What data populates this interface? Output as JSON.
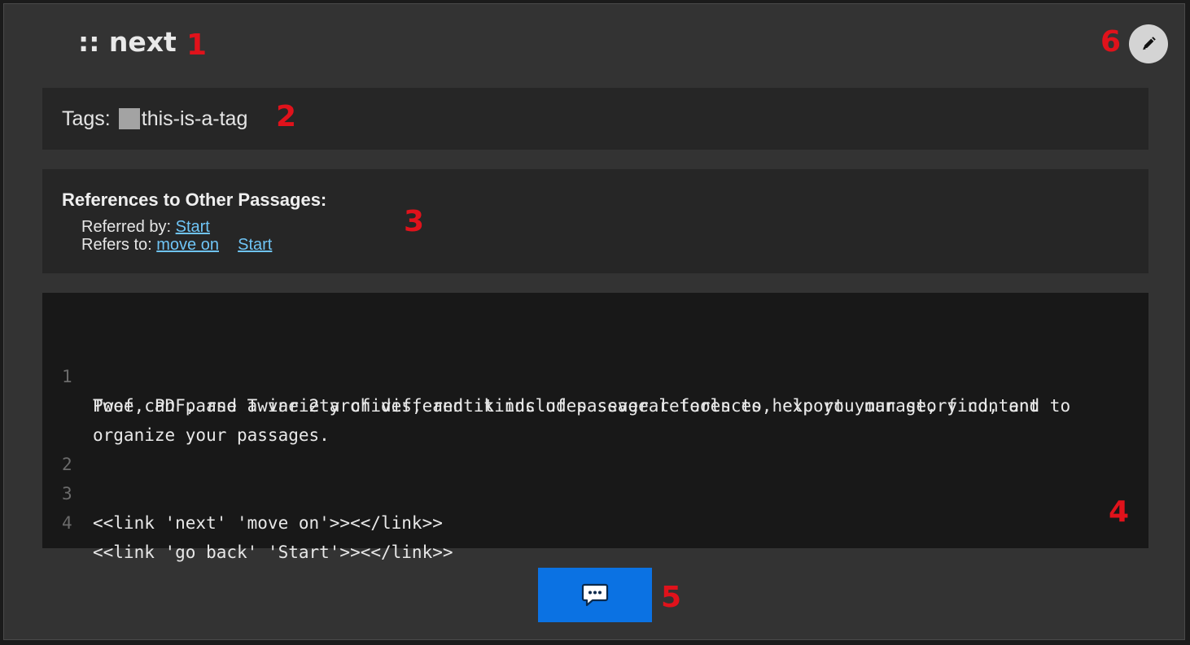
{
  "passage": {
    "title": ":: next"
  },
  "markers": {
    "title": "1",
    "tags": "2",
    "references": "3",
    "editor": "4",
    "comment": "5",
    "edit": "6"
  },
  "tags": {
    "label": "Tags:",
    "items": [
      "this-is-a-tag"
    ]
  },
  "references": {
    "heading": "References to Other Passages:",
    "referred_by_label": "Referred by:",
    "referred_by": [
      "Start"
    ],
    "refers_to_label": "Refers to:",
    "refers_to": [
      "move on",
      "Start"
    ]
  },
  "editor": {
    "line_numbers": [
      "1",
      "2",
      "3",
      "4"
    ],
    "lines": [
      "Poof can parse a variety of different kinds of passage references, export your story content to",
      "Twee, PDF, and Twine 2 archives, and it includes several tools to help you manage, find, and",
      "organize your passages.",
      "",
      "<<link 'next' 'move on'>><</link>>",
      "<<link 'go back' 'Start'>><</link>>"
    ]
  },
  "buttons": {
    "comment_icon": "comment-icon",
    "edit_icon": "pencil-icon"
  },
  "colors": {
    "accent_button": "#0b72e3",
    "link": "#6fc4f5",
    "marker": "#e0121b",
    "tag_swatch": "#a3a3a3"
  }
}
